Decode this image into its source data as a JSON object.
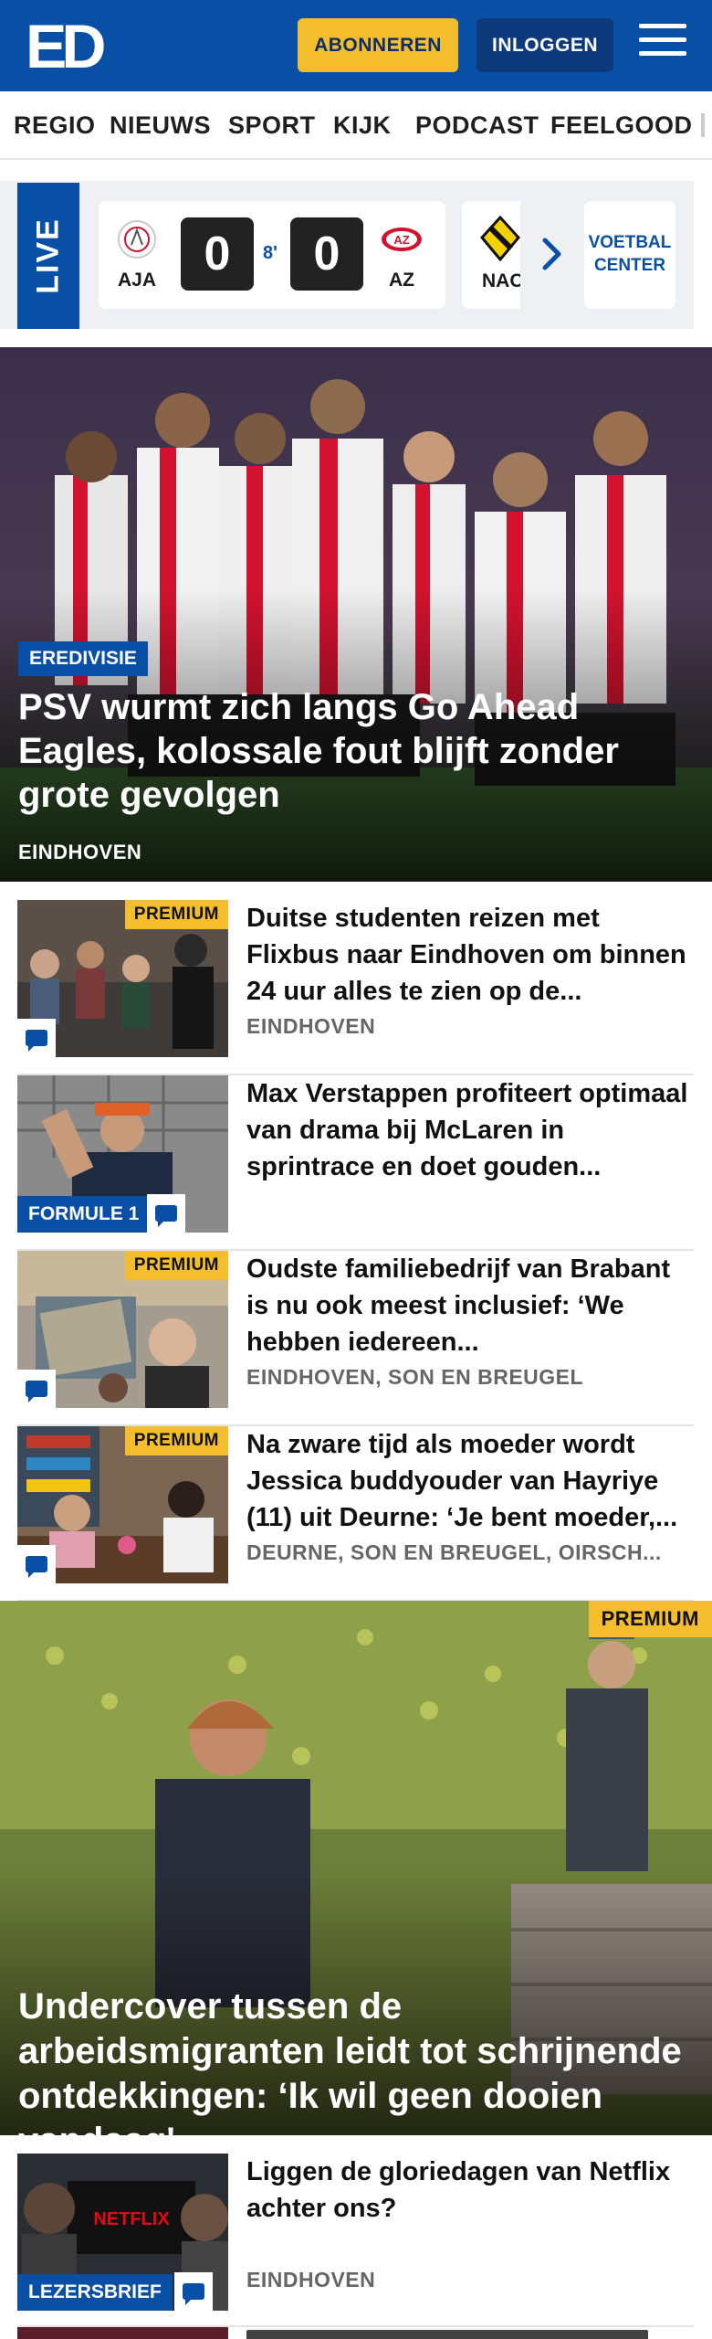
{
  "header": {
    "logo_text": "ED",
    "subscribe_label": "ABONNEREN",
    "login_label": "INLOGGEN",
    "menu_icon": "hamburger-menu-icon",
    "brand_color": "#0a4fa6",
    "accent_color": "#f3bd2e"
  },
  "nav": {
    "items": [
      "REGIO",
      "NIEUWS",
      "SPORT",
      "KIJK",
      "PODCAST",
      "FEELGOOD"
    ]
  },
  "live": {
    "label": "LIVE",
    "match": {
      "home": "AJA",
      "home_score": "0",
      "minute": "8'",
      "away_score": "0",
      "away": "AZ"
    },
    "next_club": "NAC",
    "voetbal_center_label": "VOETBAL CENTER"
  },
  "hero": {
    "tag": "EREDIVISIE",
    "title": "PSV wurmt zich langs Go Ahead Eagles, kolossale fout blijft zonder grote gevolgen",
    "location": "EINDHOVEN"
  },
  "articles": [
    {
      "premium": "PREMIUM",
      "title": "Duitse studenten reizen met Flixbus naar Eindhoven om binnen 24 uur alles te zien op de...",
      "location": "EINDHOVEN"
    },
    {
      "tag": "FORMULE 1",
      "title": "Max Verstappen profiteert optimaal van drama bij McLaren in sprintrace en doet gouden...",
      "location": ""
    },
    {
      "premium": "PREMIUM",
      "title": "Oudste familiebedrijf van Brabant is nu ook meest inclusief: ‘We hebben iedereen...",
      "location": "EINDHOVEN, SON EN BREUGEL"
    },
    {
      "premium": "PREMIUM",
      "title": "Na zware tijd als moeder wordt Jessica buddyouder van Hayriye (11) uit Deurne: ‘Je bent moeder,...",
      "location": "DEURNE, SON EN BREUGEL, OIRSCH..."
    }
  ],
  "feature": {
    "premium": "PREMIUM",
    "title": "Undercover tussen de arbeidsmigranten leidt tot schrijnende ontdekkingen: ‘Ik wil geen dooien vandaag'"
  },
  "article5": {
    "tag": "LEZERSBRIEF",
    "title": "Liggen de gloriedagen van Netflix achter ons?",
    "location": "EINDHOVEN",
    "thumb_text": "NETFLIX"
  }
}
